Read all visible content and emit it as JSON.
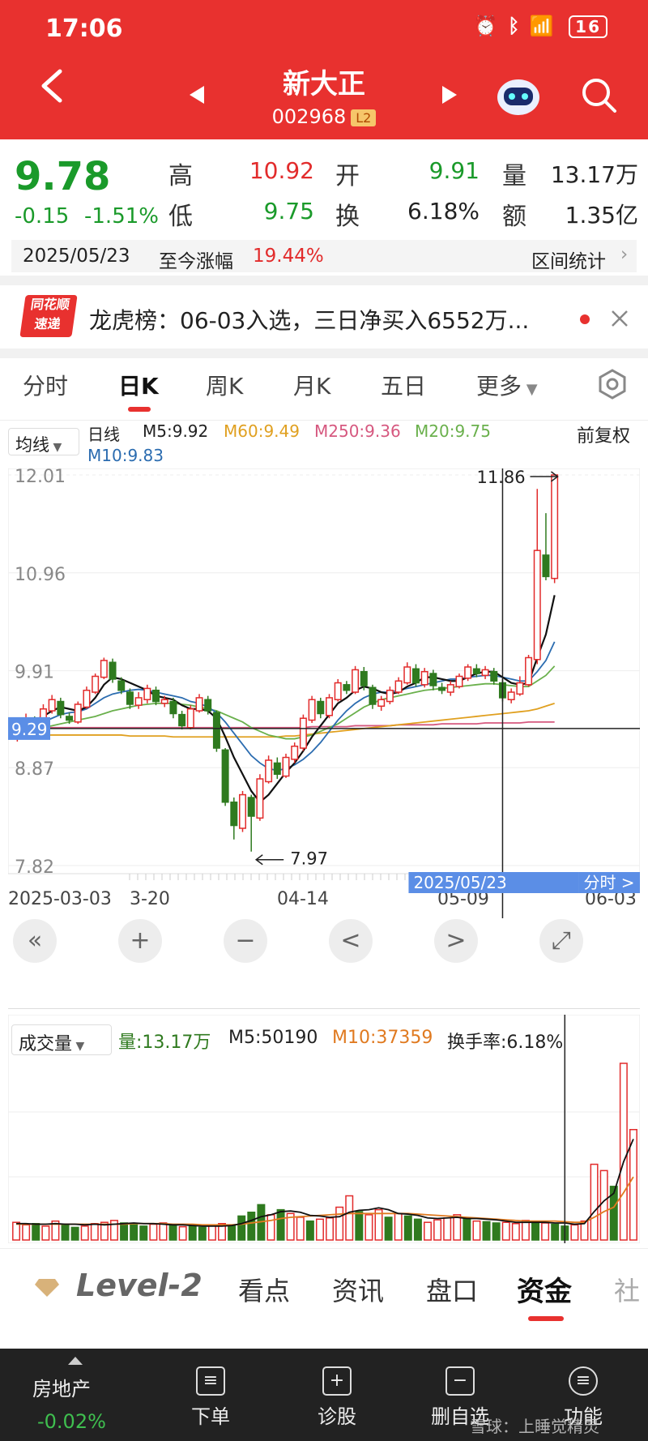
{
  "status_bar": {
    "time": "17:06",
    "battery": "16"
  },
  "header": {
    "title": "新大正",
    "code": "002968",
    "badge": "L2"
  },
  "quote": {
    "price": "9.78",
    "change": "-0.15",
    "change_pct": "-1.51%",
    "high_label": "高",
    "high": "10.92",
    "low_label": "低",
    "low": "9.75",
    "open_label": "开",
    "open": "9.91",
    "turnover_label": "换",
    "turnover": "6.18%",
    "volume_label": "量",
    "volume": "13.17万",
    "amount_label": "额",
    "amount": "1.35亿"
  },
  "range_bar": {
    "date": "2025/05/23",
    "label": "至今涨幅",
    "value": "19.44%",
    "stats": "区间统计"
  },
  "dragon_tiger": {
    "logo_top": "同花顺",
    "logo_bottom": "速递",
    "text": "龙虎榜：06-03入选，三日净买入6552万..."
  },
  "tabs": [
    "分时",
    "日K",
    "周K",
    "月K",
    "五日",
    "更多"
  ],
  "indicators": {
    "ma_button": "均线",
    "period": "日线",
    "m5": "M5:9.92",
    "m60": "M60:9.49",
    "m250": "M250:9.36",
    "m20": "M20:9.75",
    "m10": "M10:9.83",
    "adjust": "前复权"
  },
  "colors": {
    "up": "#e22b2b",
    "down": "#2f7a1f",
    "m5": "#111111",
    "m10": "#2b6cb0",
    "m20": "#6ab04c",
    "m60": "#e0a020",
    "m250": "#d6587f"
  },
  "chart_data": [
    {
      "type": "candlestick",
      "y_ticks": [
        "12.01",
        "10.96",
        "9.91",
        "8.87",
        "7.82"
      ],
      "ylim": [
        7.82,
        12.01
      ],
      "x_labels": [
        "2025-03-03",
        "3-20",
        "04-14",
        "05-09",
        "06-03"
      ],
      "crosshair_price": "9.29",
      "crosshair_date": "2025/05/23",
      "crosshair_mode": "分时",
      "max_label": "11.86",
      "min_label": "7.97",
      "candles": [
        [
          9.2,
          9.32,
          9.35,
          9.15
        ],
        [
          9.28,
          9.4,
          9.45,
          9.24
        ],
        [
          9.38,
          9.3,
          9.42,
          9.26
        ],
        [
          9.3,
          9.5,
          9.55,
          9.28
        ],
        [
          9.48,
          9.6,
          9.65,
          9.45
        ],
        [
          9.58,
          9.44,
          9.62,
          9.4
        ],
        [
          9.42,
          9.38,
          9.46,
          9.34
        ],
        [
          9.36,
          9.55,
          9.58,
          9.34
        ],
        [
          9.52,
          9.7,
          9.74,
          9.5
        ],
        [
          9.68,
          9.85,
          9.88,
          9.66
        ],
        [
          9.84,
          10.02,
          10.05,
          9.82
        ],
        [
          10.0,
          9.82,
          10.04,
          9.78
        ],
        [
          9.8,
          9.7,
          9.84,
          9.66
        ],
        [
          9.68,
          9.55,
          9.72,
          9.5
        ],
        [
          9.54,
          9.62,
          9.68,
          9.5
        ],
        [
          9.6,
          9.72,
          9.76,
          9.56
        ],
        [
          9.7,
          9.58,
          9.74,
          9.54
        ],
        [
          9.56,
          9.6,
          9.64,
          9.52
        ],
        [
          9.58,
          9.45,
          9.62,
          9.4
        ],
        [
          9.44,
          9.32,
          9.48,
          9.28
        ],
        [
          9.3,
          9.5,
          9.54,
          9.28
        ],
        [
          9.48,
          9.62,
          9.66,
          9.46
        ],
        [
          9.6,
          9.48,
          9.64,
          9.44
        ],
        [
          9.46,
          9.08,
          9.48,
          9.04
        ],
        [
          9.06,
          8.5,
          9.08,
          8.46
        ],
        [
          8.5,
          8.25,
          8.55,
          8.1
        ],
        [
          8.22,
          8.58,
          8.62,
          8.18
        ],
        [
          8.55,
          8.35,
          8.58,
          7.97
        ],
        [
          8.33,
          8.75,
          8.8,
          8.3
        ],
        [
          8.72,
          8.95,
          9.0,
          8.7
        ],
        [
          8.92,
          8.8,
          8.98,
          8.75
        ],
        [
          8.78,
          8.98,
          9.02,
          8.76
        ],
        [
          8.96,
          9.1,
          9.14,
          8.92
        ],
        [
          9.08,
          9.4,
          9.44,
          9.05
        ],
        [
          9.38,
          9.6,
          9.64,
          9.35
        ],
        [
          9.58,
          9.45,
          9.62,
          9.4
        ],
        [
          9.43,
          9.62,
          9.66,
          9.4
        ],
        [
          9.6,
          9.78,
          9.82,
          9.58
        ],
        [
          9.76,
          9.7,
          9.8,
          9.66
        ],
        [
          9.68,
          9.92,
          9.96,
          9.66
        ],
        [
          9.9,
          9.75,
          9.95,
          9.7
        ],
        [
          9.73,
          9.55,
          9.76,
          9.5
        ],
        [
          9.53,
          9.6,
          9.64,
          9.48
        ],
        [
          9.58,
          9.7,
          9.74,
          9.55
        ],
        [
          9.68,
          9.8,
          9.84,
          9.66
        ],
        [
          9.78,
          9.95,
          10.0,
          9.76
        ],
        [
          9.93,
          9.78,
          9.98,
          9.74
        ],
        [
          9.76,
          9.9,
          9.94,
          9.73
        ],
        [
          9.88,
          9.75,
          9.92,
          9.7
        ],
        [
          9.73,
          9.7,
          9.78,
          9.66
        ],
        [
          9.68,
          9.76,
          9.8,
          9.64
        ],
        [
          9.74,
          9.85,
          9.88,
          9.72
        ],
        [
          9.83,
          9.95,
          9.98,
          9.8
        ],
        [
          9.93,
          9.88,
          9.98,
          9.84
        ],
        [
          9.86,
          9.92,
          9.96,
          9.82
        ],
        [
          9.9,
          9.8,
          9.94,
          9.76
        ],
        [
          9.78,
          9.62,
          9.82,
          9.58
        ],
        [
          9.6,
          9.68,
          9.72,
          9.56
        ],
        [
          9.66,
          9.78,
          9.85,
          9.64
        ],
        [
          9.76,
          10.05,
          10.08,
          9.74
        ],
        [
          10.03,
          11.2,
          11.86,
          9.98
        ],
        [
          11.15,
          10.92,
          11.6,
          10.88
        ],
        [
          10.9,
          12.01,
          12.01,
          10.85
        ]
      ],
      "ma": {
        "m5": [
          9.3,
          9.35,
          9.38,
          9.42,
          9.48,
          9.52,
          9.5,
          9.48,
          9.52,
          9.62,
          9.76,
          9.84,
          9.82,
          9.78,
          9.74,
          9.7,
          9.64,
          9.62,
          9.6,
          9.54,
          9.5,
          9.5,
          9.48,
          9.4,
          9.2,
          8.98,
          8.8,
          8.62,
          8.5,
          8.58,
          8.7,
          8.82,
          8.92,
          9.05,
          9.2,
          9.32,
          9.44,
          9.56,
          9.62,
          9.7,
          9.74,
          9.72,
          9.68,
          9.66,
          9.68,
          9.74,
          9.78,
          9.84,
          9.84,
          9.82,
          9.8,
          9.8,
          9.84,
          9.88,
          9.9,
          9.9,
          9.84,
          9.78,
          9.76,
          9.78,
          10.05,
          10.3,
          10.72
        ],
        "m10": [
          9.28,
          9.3,
          9.33,
          9.36,
          9.4,
          9.44,
          9.46,
          9.47,
          9.5,
          9.56,
          9.62,
          9.66,
          9.68,
          9.7,
          9.71,
          9.7,
          9.68,
          9.66,
          9.64,
          9.62,
          9.58,
          9.56,
          9.52,
          9.46,
          9.36,
          9.24,
          9.12,
          9.0,
          8.92,
          8.86,
          8.84,
          8.86,
          8.9,
          8.96,
          9.04,
          9.14,
          9.26,
          9.38,
          9.48,
          9.56,
          9.62,
          9.66,
          9.68,
          9.68,
          9.7,
          9.72,
          9.74,
          9.76,
          9.78,
          9.8,
          9.82,
          9.82,
          9.84,
          9.85,
          9.86,
          9.86,
          9.84,
          9.82,
          9.8,
          9.8,
          9.9,
          10.02,
          10.22
        ],
        "m20": [
          9.25,
          9.26,
          9.28,
          9.3,
          9.32,
          9.34,
          9.36,
          9.38,
          9.4,
          9.42,
          9.45,
          9.48,
          9.5,
          9.52,
          9.54,
          9.55,
          9.56,
          9.56,
          9.56,
          9.55,
          9.54,
          9.52,
          9.5,
          9.48,
          9.44,
          9.4,
          9.36,
          9.3,
          9.26,
          9.22,
          9.2,
          9.18,
          9.18,
          9.2,
          9.22,
          9.26,
          9.3,
          9.34,
          9.4,
          9.46,
          9.52,
          9.56,
          9.6,
          9.62,
          9.64,
          9.66,
          9.68,
          9.7,
          9.71,
          9.72,
          9.73,
          9.74,
          9.75,
          9.76,
          9.77,
          9.77,
          9.76,
          9.75,
          9.74,
          9.74,
          9.8,
          9.86,
          9.96
        ],
        "m60": [
          9.22,
          9.22,
          9.22,
          9.22,
          9.22,
          9.22,
          9.22,
          9.22,
          9.22,
          9.22,
          9.22,
          9.22,
          9.22,
          9.21,
          9.21,
          9.21,
          9.21,
          9.21,
          9.2,
          9.2,
          9.2,
          9.2,
          9.2,
          9.2,
          9.2,
          9.2,
          9.2,
          9.2,
          9.2,
          9.2,
          9.2,
          9.21,
          9.21,
          9.22,
          9.23,
          9.24,
          9.25,
          9.26,
          9.27,
          9.28,
          9.29,
          9.3,
          9.31,
          9.32,
          9.33,
          9.34,
          9.35,
          9.36,
          9.37,
          9.38,
          9.39,
          9.4,
          9.41,
          9.42,
          9.43,
          9.44,
          9.45,
          9.46,
          9.47,
          9.48,
          9.5,
          9.53,
          9.56
        ],
        "m250": [
          9.3,
          9.3,
          9.3,
          9.3,
          9.3,
          9.3,
          9.3,
          9.3,
          9.3,
          9.3,
          9.3,
          9.3,
          9.3,
          9.3,
          9.3,
          9.3,
          9.3,
          9.3,
          9.3,
          9.3,
          9.3,
          9.3,
          9.3,
          9.3,
          9.3,
          9.3,
          9.3,
          9.3,
          9.3,
          9.3,
          9.3,
          9.3,
          9.3,
          9.3,
          9.31,
          9.31,
          9.31,
          9.31,
          9.31,
          9.32,
          9.32,
          9.32,
          9.32,
          9.32,
          9.33,
          9.33,
          9.33,
          9.33,
          9.33,
          9.34,
          9.34,
          9.34,
          9.34,
          9.34,
          9.35,
          9.35,
          9.35,
          9.35,
          9.35,
          9.36,
          9.36,
          9.36,
          9.36
        ]
      }
    },
    {
      "type": "bar",
      "title": "成交量",
      "labels": {
        "volume": "量:13.17万",
        "m5": "M5:50190",
        "m10": "M10:37359",
        "turnover": "换手率:6.18%"
      },
      "values": [
        28000,
        24000,
        26000,
        22000,
        30000,
        25000,
        20000,
        22000,
        26000,
        28000,
        31000,
        27000,
        24000,
        22000,
        25000,
        27000,
        23000,
        21000,
        22000,
        20000,
        24000,
        26000,
        23000,
        38000,
        44000,
        56000,
        40000,
        48000,
        42000,
        36000,
        30000,
        33000,
        35000,
        52000,
        70000,
        45000,
        40000,
        48000,
        36000,
        42000,
        38000,
        33000,
        28000,
        32000,
        35000,
        40000,
        34000,
        30000,
        29000,
        27000,
        28000,
        26000,
        31000,
        29000,
        27000,
        25000,
        22000,
        24000,
        30000,
        120000,
        110000,
        85000,
        280000,
        175000
      ],
      "up": [
        true,
        true,
        false,
        true,
        true,
        false,
        false,
        true,
        true,
        true,
        true,
        false,
        false,
        false,
        true,
        true,
        false,
        true,
        false,
        false,
        true,
        true,
        false,
        false,
        false,
        false,
        true,
        false,
        true,
        true,
        false,
        true,
        true,
        true,
        true,
        false,
        true,
        true,
        false,
        true,
        false,
        false,
        true,
        true,
        true,
        true,
        false,
        true,
        false,
        false,
        true,
        true,
        true,
        false,
        true,
        false,
        false,
        true,
        true,
        true,
        true,
        false,
        true,
        true
      ],
      "m5": [
        26000,
        26000,
        25000,
        25000,
        26000,
        25000,
        25000,
        24000,
        25000,
        24000,
        25000,
        26000,
        27000,
        26000,
        26000,
        25000,
        24000,
        24000,
        23000,
        22000,
        22000,
        22000,
        23000,
        26000,
        31000,
        37000,
        40000,
        45000,
        46000,
        44000,
        39000,
        38000,
        36000,
        37000,
        44000,
        47000,
        48000,
        51000,
        48000,
        42000,
        41000,
        39000,
        35000,
        34000,
        35000,
        36000,
        34000,
        34000,
        33000,
        32000,
        30000,
        28000,
        28000,
        28000,
        28000,
        27000,
        27000,
        25000,
        26000,
        45000,
        62000,
        74000,
        124000,
        160000
      ],
      "m10": [
        25000,
        25000,
        25000,
        25000,
        25000,
        25000,
        25000,
        25000,
        25000,
        25000,
        25000,
        25000,
        26000,
        26000,
        26000,
        26000,
        25000,
        25000,
        25000,
        24000,
        24000,
        24000,
        24000,
        25000,
        27000,
        29000,
        31000,
        34000,
        36000,
        37000,
        38000,
        39000,
        40000,
        41000,
        42000,
        42000,
        42000,
        42000,
        42000,
        42000,
        42000,
        41000,
        40000,
        39000,
        38000,
        37000,
        36000,
        35000,
        34000,
        33000,
        32000,
        31000,
        30000,
        30000,
        30000,
        30000,
        29000,
        28000,
        28000,
        36000,
        45000,
        52000,
        75000,
        100000
      ]
    }
  ],
  "chart_controls": {
    "rewind": "«",
    "zoom_in": "+",
    "zoom_out": "−",
    "prev": "<",
    "next": ">",
    "fullscreen": "⤢"
  },
  "bottom_tabs": [
    "Level-2",
    "看点",
    "资讯",
    "盘口",
    "资金",
    "社"
  ],
  "footer": {
    "sector_name": "房地产",
    "sector_change": "-0.02%",
    "items": [
      "下单",
      "诊股",
      "删自选",
      "功能"
    ],
    "watermark": "雪球：上睡觉精灵"
  }
}
